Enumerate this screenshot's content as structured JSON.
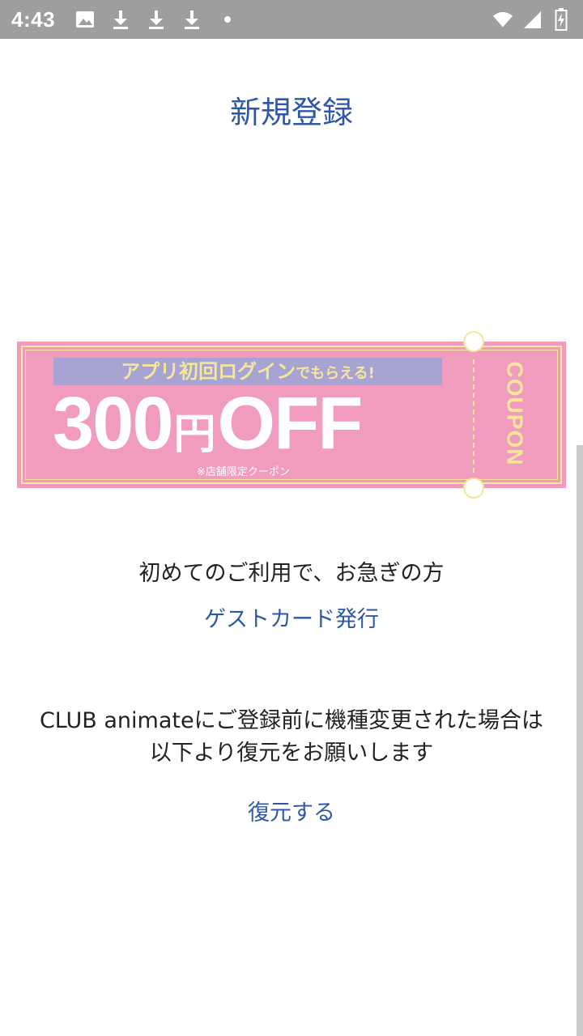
{
  "status_bar": {
    "time": "4:43",
    "icons": [
      "image-icon",
      "download-icon",
      "download-icon",
      "download-icon",
      "dot-icon",
      "wifi-icon",
      "cell-signal-icon",
      "battery-icon"
    ]
  },
  "title": "新規登録",
  "banner": {
    "top_strip_main": "アプリ初回ログイン",
    "top_strip_suffix": "でもらえる!",
    "amount": "300",
    "currency": "円",
    "off": "OFF",
    "note": "※店舗限定クーポン",
    "coupon_label": "COUPON",
    "colors": {
      "background": "#f19bbf",
      "strip": "#a7a3d3",
      "accent": "#f6e69a"
    }
  },
  "guest_section": {
    "description": "初めてのご利用で、お急ぎの方",
    "link": "ゲストカード発行"
  },
  "restore_section": {
    "description_line1": "CLUB animateにご登録前に機種変更された場合は",
    "description_line2": "以下より復元をお願いします",
    "link": "復元する"
  }
}
